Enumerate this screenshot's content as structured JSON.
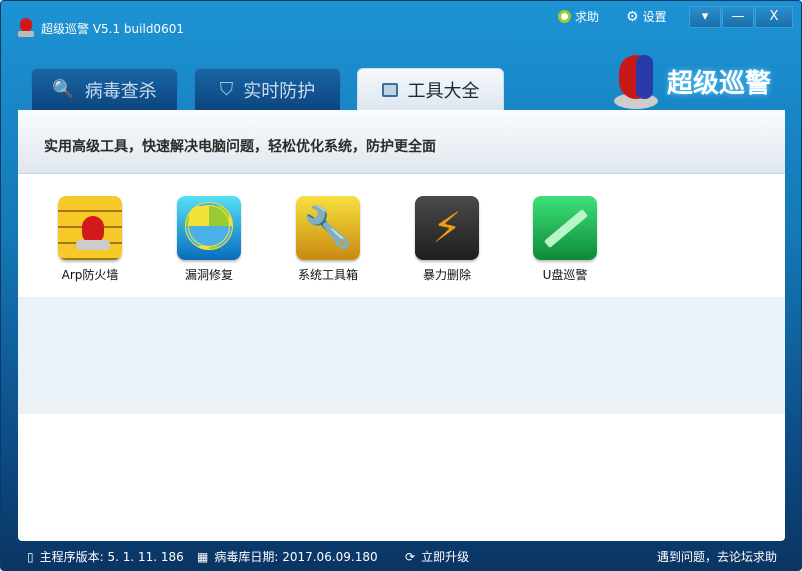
{
  "app": {
    "title": "超级巡警 V5.1 build0601",
    "logo_text": "超级巡警"
  },
  "top_links": {
    "help": "求助",
    "settings": "设置"
  },
  "window_buttons": {
    "menu": "▾",
    "minimize": "—",
    "close": "X"
  },
  "tabs": [
    {
      "label": "病毒查杀",
      "icon": "search-icon"
    },
    {
      "label": "实时防护",
      "icon": "shield-icon"
    },
    {
      "label": "工具大全",
      "icon": "toolbox-icon",
      "active": true
    }
  ],
  "banner": "实用高级工具，快速解决电脑问题，轻松优化系统，防护更全面",
  "tools": [
    {
      "label": "Arp防火墙",
      "icon": "firewall-icon"
    },
    {
      "label": "漏洞修复",
      "icon": "vulnerability-icon"
    },
    {
      "label": "系统工具箱",
      "icon": "tools-icon"
    },
    {
      "label": "暴力删除",
      "icon": "lightning-icon"
    },
    {
      "label": "U盘巡警",
      "icon": "syringe-icon"
    }
  ],
  "status": {
    "version": "主程序版本: 5. 1. 11. 186",
    "db_date": "病毒库日期: 2017.06.09.180",
    "upgrade": "立即升级",
    "forum": "遇到问题，去论坛求助"
  }
}
